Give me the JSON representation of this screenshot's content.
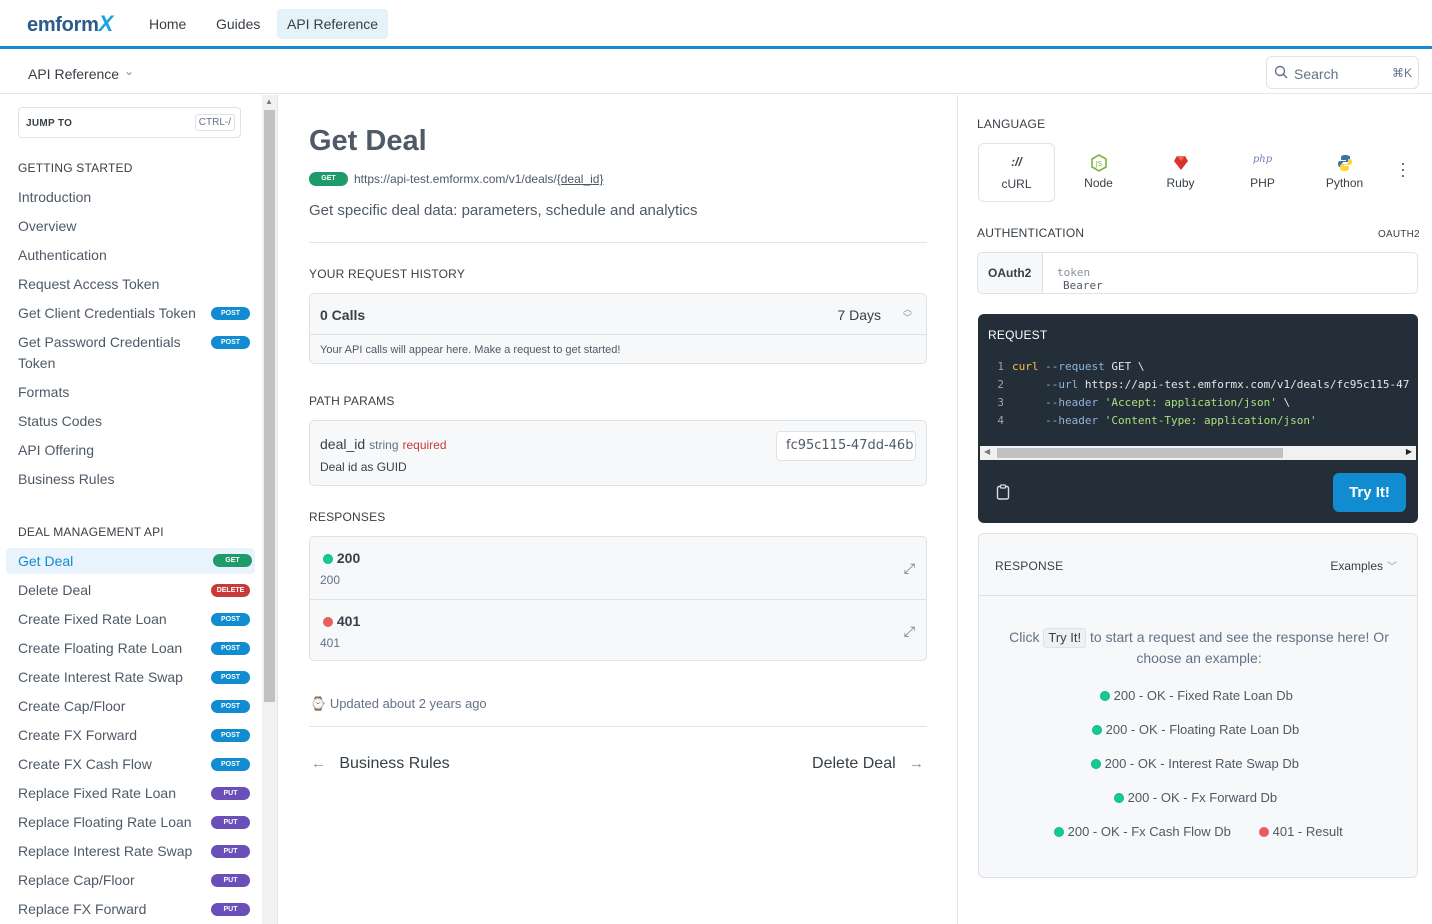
{
  "brand": {
    "name": "emform",
    "x": "X"
  },
  "topnav": {
    "items": [
      "Home",
      "Guides",
      "API Reference"
    ]
  },
  "subbar": {
    "title": "API Reference",
    "chevron": "⌄"
  },
  "search": {
    "placeholder": "Search",
    "shortcut": "⌘K"
  },
  "sidebar": {
    "jump_label": "JUMP TO",
    "jump_shortcut": "CTRL-/",
    "section1": "GETTING STARTED",
    "items1": [
      {
        "label": "Introduction"
      },
      {
        "label": "Overview"
      },
      {
        "label": "Authentication"
      },
      {
        "label": "Request Access Token"
      },
      {
        "label": "Get Client Credentials Token",
        "badge": "POST"
      },
      {
        "label": "Get Password Credentials Token",
        "badge": "POST"
      },
      {
        "label": "Formats"
      },
      {
        "label": "Status Codes"
      },
      {
        "label": "API Offering"
      },
      {
        "label": "Business Rules"
      }
    ],
    "section2": "DEAL MANAGEMENT API",
    "items2": [
      {
        "label": "Get Deal",
        "badge": "GET",
        "active": true
      },
      {
        "label": "Delete Deal",
        "badge": "DELETE"
      },
      {
        "label": "Create Fixed Rate Loan",
        "badge": "POST"
      },
      {
        "label": "Create Floating Rate Loan",
        "badge": "POST"
      },
      {
        "label": "Create Interest Rate Swap",
        "badge": "POST"
      },
      {
        "label": "Create Cap/Floor",
        "badge": "POST"
      },
      {
        "label": "Create FX Forward",
        "badge": "POST"
      },
      {
        "label": "Create FX Cash Flow",
        "badge": "POST"
      },
      {
        "label": "Replace Fixed Rate Loan",
        "badge": "PUT"
      },
      {
        "label": "Replace Floating Rate Loan",
        "badge": "PUT"
      },
      {
        "label": "Replace Interest Rate Swap",
        "badge": "PUT"
      },
      {
        "label": "Replace Cap/Floor",
        "badge": "PUT"
      },
      {
        "label": "Replace FX Forward",
        "badge": "PUT"
      }
    ]
  },
  "main": {
    "title": "Get Deal",
    "method": "GET",
    "url_prefix": "https://api-test.emformx.com/v1/deals/",
    "url_param": "{deal_id}",
    "description": "Get specific deal data: parameters, schedule and analytics",
    "history_label": "YOUR REQUEST HISTORY",
    "calls": "0 Calls",
    "days": "7 Days",
    "history_msg": "Your API calls will appear here. Make a request to get started!",
    "path_params_label": "PATH PARAMS",
    "param_name": "deal_id",
    "param_type": "string",
    "param_required": "required",
    "param_desc": "Deal id as GUID",
    "param_value": "fc95c115-47dd-46b",
    "responses_label": "RESPONSES",
    "responses": [
      {
        "code": "200",
        "desc": "200"
      },
      {
        "code": "401",
        "desc": "401"
      }
    ],
    "updated": "Updated about 2 years ago",
    "prev": "Business Rules",
    "next": "Delete Deal"
  },
  "right": {
    "language_label": "LANGUAGE",
    "languages": [
      {
        "name": "cURL",
        "icon": "curl-icon"
      },
      {
        "name": "Node",
        "icon": "node-icon"
      },
      {
        "name": "Ruby",
        "icon": "ruby-icon"
      },
      {
        "name": "PHP",
        "icon": "php-icon"
      },
      {
        "name": "Python",
        "icon": "python-icon"
      }
    ],
    "auth_label": "AUTHENTICATION",
    "auth_type": "OAUTH2",
    "auth_scheme": "OAuth2",
    "bearer": "Bearer",
    "token_placeholder": "token",
    "request_label": "REQUEST",
    "code_lines": [
      {
        "n": "1",
        "a": "curl",
        "b": " --request",
        "c": " GET \\"
      },
      {
        "n": "2",
        "b": "     --url",
        "c": " https://api-test.emformx.com/v1/deals/fc95c115-47"
      },
      {
        "n": "3",
        "b": "     --header",
        "s": " 'Accept: application/json'",
        "c": " \\"
      },
      {
        "n": "4",
        "b": "     --header",
        "s": " 'Content-Type: application/json'"
      }
    ],
    "try_label": "Try It!",
    "response_label": "RESPONSE",
    "examples_label": "Examples",
    "intro_before": "Click",
    "intro_chip": "Try It!",
    "intro_after": "to start a request and see the response here! Or choose an example:",
    "examples": [
      {
        "label": "200 - OK - Fixed Rate Loan Db",
        "status": "ok"
      },
      {
        "label": "200 - OK - Floating Rate Loan Db",
        "status": "ok"
      },
      {
        "label": "200 - OK - Interest Rate Swap Db",
        "status": "ok"
      },
      {
        "label": "200 - OK - Fx Forward Db",
        "status": "ok"
      },
      {
        "label": "200 - OK - Fx Cash Flow Db",
        "status": "ok"
      },
      {
        "label": "401 - Result",
        "status": "error"
      }
    ]
  },
  "colors": {
    "accent": "#118cd1",
    "get": "#1f9b6b",
    "delete": "#c83b3b",
    "put": "#6b4fb9",
    "code_bg": "#242e38"
  }
}
